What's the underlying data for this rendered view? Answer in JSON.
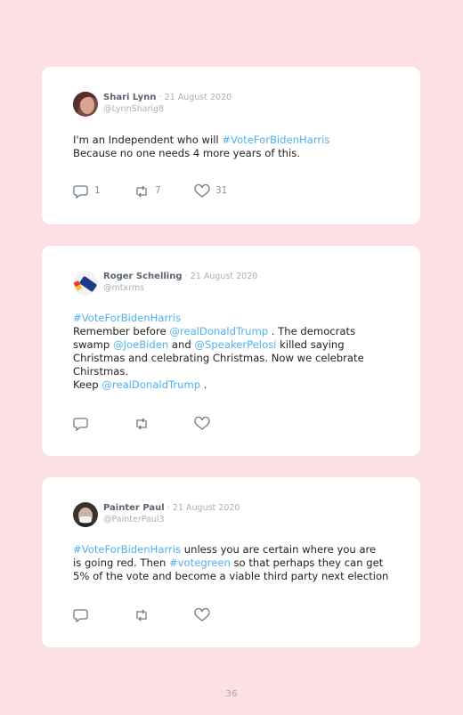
{
  "tweets": [
    {
      "name": "Shari Lynn",
      "date": "· 21 August 2020",
      "handle": "@LynnSharig8",
      "line1_pre": "I'm an Independent who will ",
      "line1_tag": "#VoteForBidenHarris",
      "line2": "Because no one needs 4 more years of this.",
      "reply_count": "1",
      "retweet_count": "7",
      "like_count": "31"
    },
    {
      "name": "Roger Schelling",
      "date": "· 21 August 2020",
      "handle": "@mtxrms",
      "tag": "#VoteForBidenHarris",
      "l2_pre": "Remember before ",
      "l2_mention": "@realDonaldTrump",
      "l2_post": " . The democrats",
      "l3_pre": "swamp ",
      "l3_m1": "@JoeBiden",
      "l3_mid": " and ",
      "l3_m2": "@SpeakerPelosi",
      "l3_post": " killed saying",
      "l4": "Christmas and celebrating Christmas. Now we celebrate",
      "l5": "Chirstmas.",
      "l6_pre": "Keep ",
      "l6_mention": "@realDonaldTrump",
      "l6_post": " ."
    },
    {
      "name": "Painter Paul",
      "date": "· 21 August 2020",
      "handle": "@PainterPaul3",
      "l1_tag": "#VoteForBidenHarris",
      "l1_post": " unless you are certain where you are",
      "l2_pre": "is going red. Then ",
      "l2_tag": "#votegreen",
      "l2_post": " so that perhaps they can get",
      "l3": "5% of the vote and become a viable third party next election"
    }
  ],
  "page_number": "36",
  "colors": {
    "background": "#fde0e4",
    "link": "#4fb1f0",
    "card": "#ffffff"
  },
  "icons": [
    "reply-icon",
    "retweet-icon",
    "like-icon"
  ]
}
